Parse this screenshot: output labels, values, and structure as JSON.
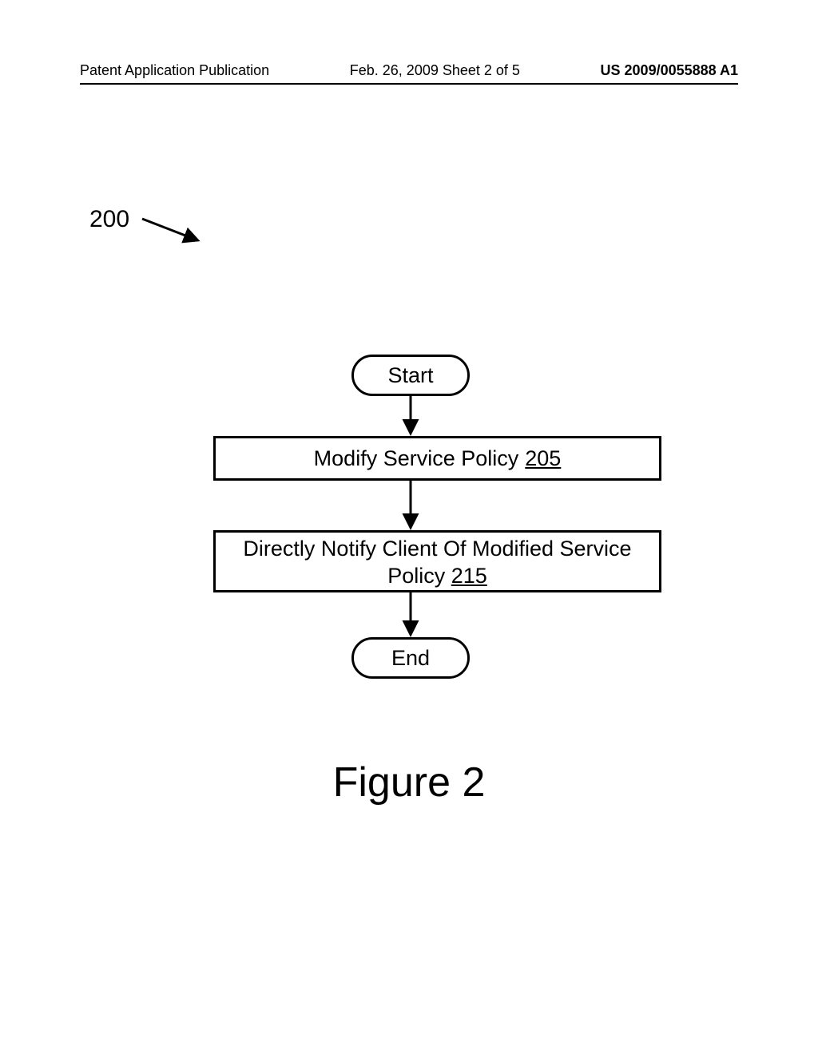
{
  "header": {
    "left": "Patent Application Publication",
    "center": "Feb. 26, 2009  Sheet 2 of 5",
    "right": "US 2009/0055888 A1"
  },
  "reference_number": "200",
  "start_label": "Start",
  "box1": {
    "text": "Modify Service Policy",
    "ref": "205"
  },
  "box2": {
    "text": "Directly Notify Client Of Modified Service Policy",
    "ref": "215"
  },
  "end_label": "End",
  "figure_title": "Figure 2",
  "chart_data": {
    "type": "flowchart",
    "reference": "200",
    "nodes": [
      {
        "id": "start",
        "shape": "terminator",
        "label": "Start"
      },
      {
        "id": "n205",
        "shape": "process",
        "label": "Modify Service Policy",
        "ref": "205"
      },
      {
        "id": "n215",
        "shape": "process",
        "label": "Directly Notify Client Of Modified Service Policy",
        "ref": "215"
      },
      {
        "id": "end",
        "shape": "terminator",
        "label": "End"
      }
    ],
    "edges": [
      {
        "from": "start",
        "to": "n205"
      },
      {
        "from": "n205",
        "to": "n215"
      },
      {
        "from": "n215",
        "to": "end"
      }
    ],
    "figure_title": "Figure 2"
  }
}
